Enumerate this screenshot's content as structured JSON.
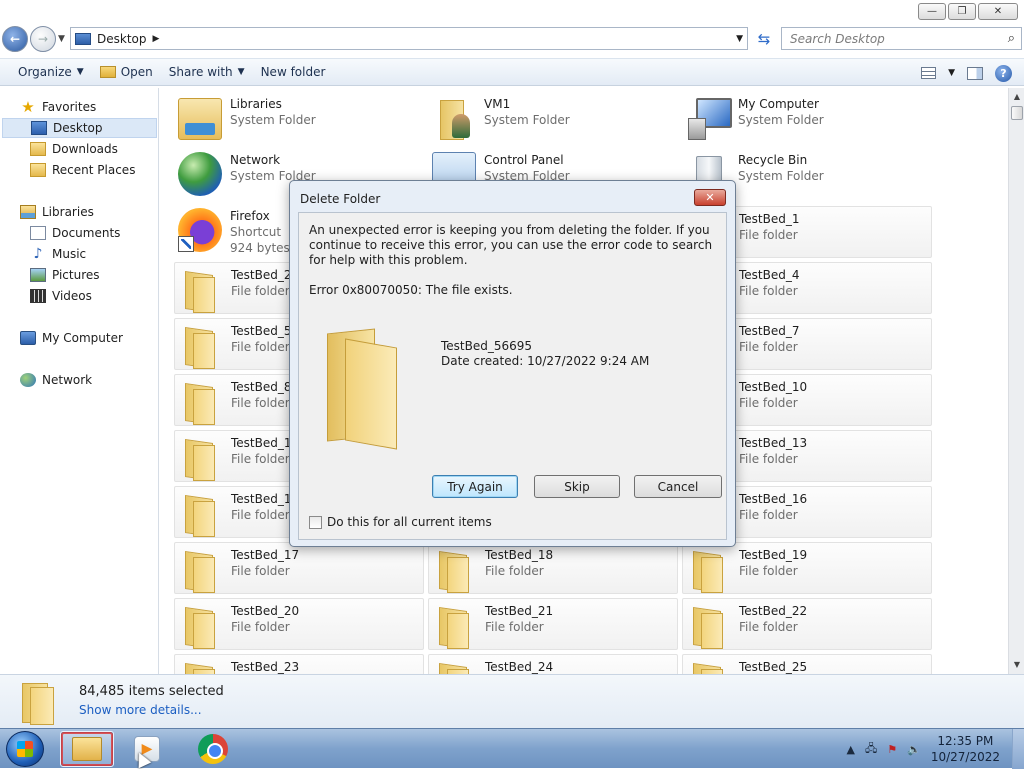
{
  "window": {
    "controls": {
      "minimize": "—",
      "maximize": "❐",
      "close": "✕"
    }
  },
  "address": {
    "location": "Desktop",
    "search_placeholder": "Search Desktop"
  },
  "toolbar": {
    "organize": "Organize",
    "open": "Open",
    "share_with": "Share with",
    "new_folder": "New folder"
  },
  "nav": {
    "favorites": "Favorites",
    "desktop": "Desktop",
    "downloads": "Downloads",
    "recent_places": "Recent Places",
    "libraries": "Libraries",
    "documents": "Documents",
    "music": "Music",
    "pictures": "Pictures",
    "videos": "Videos",
    "my_computer": "My Computer",
    "network": "Network"
  },
  "items": [
    {
      "name": "Libraries",
      "sub": "System Folder",
      "sub2": ""
    },
    {
      "name": "VM1",
      "sub": "System Folder",
      "sub2": ""
    },
    {
      "name": "My Computer",
      "sub": "System Folder",
      "sub2": ""
    },
    {
      "name": "Network",
      "sub": "System Folder",
      "sub2": ""
    },
    {
      "name": "Control Panel",
      "sub": "System Folder",
      "sub2": ""
    },
    {
      "name": "Recycle Bin",
      "sub": "System Folder",
      "sub2": ""
    },
    {
      "name": "Firefox",
      "sub": "Shortcut",
      "sub2": "924 bytes"
    },
    {
      "name": "TestBed_1",
      "sub": "File folder",
      "sub2": ""
    },
    {
      "name": "TestBed_2",
      "sub": "File folder",
      "sub2": ""
    },
    {
      "name": "TestBed_4",
      "sub": "File folder",
      "sub2": ""
    },
    {
      "name": "TestBed_5",
      "sub": "File folder",
      "sub2": ""
    },
    {
      "name": "TestBed_7",
      "sub": "File folder",
      "sub2": ""
    },
    {
      "name": "TestBed_8",
      "sub": "File folder",
      "sub2": ""
    },
    {
      "name": "TestBed_10",
      "sub": "File folder",
      "sub2": ""
    },
    {
      "name": "TestBed_11",
      "sub": "File folder",
      "sub2": ""
    },
    {
      "name": "TestBed_13",
      "sub": "File folder",
      "sub2": ""
    },
    {
      "name": "TestBed_14",
      "sub": "File folder",
      "sub2": ""
    },
    {
      "name": "TestBed_16",
      "sub": "File folder",
      "sub2": ""
    },
    {
      "name": "TestBed_17",
      "sub": "File folder",
      "sub2": ""
    },
    {
      "name": "TestBed_18",
      "sub": "File folder",
      "sub2": ""
    },
    {
      "name": "TestBed_19",
      "sub": "File folder",
      "sub2": ""
    },
    {
      "name": "TestBed_20",
      "sub": "File folder",
      "sub2": ""
    },
    {
      "name": "TestBed_21",
      "sub": "File folder",
      "sub2": ""
    },
    {
      "name": "TestBed_22",
      "sub": "File folder",
      "sub2": ""
    },
    {
      "name": "TestBed_23",
      "sub": "",
      "sub2": ""
    },
    {
      "name": "TestBed_24",
      "sub": "",
      "sub2": ""
    },
    {
      "name": "TestBed_25",
      "sub": "",
      "sub2": ""
    }
  ],
  "details": {
    "count": "84,485 items selected",
    "more": "Show more details..."
  },
  "dialog": {
    "title": "Delete Folder",
    "close": "✕",
    "message": "An unexpected error is keeping you from deleting the folder. If you continue to receive this error, you can use the error code to search for help with this problem.",
    "error": "Error 0x80070050: The file exists.",
    "folder_name": "TestBed_56695",
    "date_created": "Date created: 10/27/2022 9:24 AM",
    "try_again": "Try Again",
    "skip": "Skip",
    "cancel": "Cancel",
    "checkbox": "Do this for all current items"
  },
  "taskbar": {
    "time": "12:35 PM",
    "date": "10/27/2022",
    "tray_arrow": "▲"
  }
}
